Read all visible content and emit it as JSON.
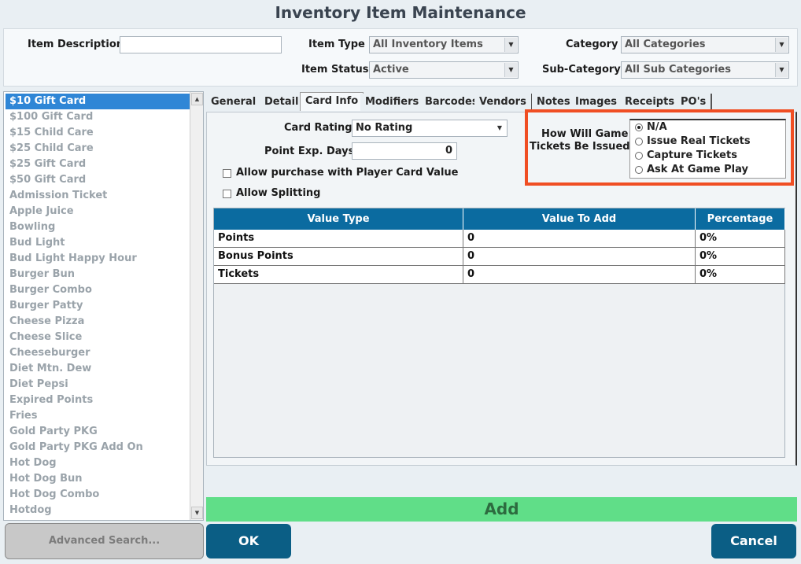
{
  "window": {
    "title": "Inventory Item Maintenance"
  },
  "filters": {
    "item_description_label": "Item Description",
    "item_description_value": "",
    "item_type_label": "Item Type",
    "item_type_value": "All Inventory Items",
    "item_status_label": "Item Status",
    "item_status_value": "Active",
    "category_label": "Category",
    "category_value": "All Categories",
    "subcategory_label": "Sub-Category",
    "subcategory_value": "All Sub Categories"
  },
  "item_list": {
    "items": [
      "$10 Gift Card",
      "$100 Gift Card",
      "$15 Child Care",
      "$25 Child Care",
      "$25 Gift Card",
      "$50 Gift Card",
      "Admission Ticket",
      "Apple Juice",
      "Bowling",
      "Bud Light",
      "Bud Light Happy Hour",
      "Burger Bun",
      "Burger Combo",
      "Burger Patty",
      "Cheese Pizza",
      "Cheese Slice",
      "Cheeseburger",
      "Diet Mtn. Dew",
      "Diet Pepsi",
      "Expired Points",
      "Fries",
      "Gold Party PKG",
      "Gold Party PKG Add On",
      "Hot Dog",
      "Hot Dog Bun",
      "Hot Dog Combo",
      "Hotdog"
    ],
    "selected_index": 0
  },
  "tabs": [
    "General",
    "Detail",
    "Card Info",
    "Modifiers",
    "Barcodes",
    "Vendors",
    "Notes",
    "Images",
    "Receipts",
    "PO's"
  ],
  "active_tab": "Card Info",
  "card_info": {
    "card_rating_label": "Card Rating",
    "card_rating_value": "No Rating",
    "point_exp_days_label": "Point Exp. Days",
    "point_exp_days_value": "0",
    "allow_purchase_label": "Allow purchase with Player Card Value",
    "allow_splitting_label": "Allow Splitting",
    "tickets_label_line1": "How Will Game",
    "tickets_label_line2": "Tickets Be Issued",
    "ticket_options": [
      "N/A",
      "Issue Real Tickets",
      "Capture Tickets",
      "Ask At Game Play"
    ],
    "ticket_selected": "N/A"
  },
  "value_table": {
    "headers": [
      "Value Type",
      "Value To Add",
      "Percentage"
    ],
    "rows": [
      [
        "Points",
        "0",
        "0%"
      ],
      [
        "Bonus Points",
        "0",
        "0%"
      ],
      [
        "Tickets",
        "0",
        "0%"
      ]
    ]
  },
  "buttons": {
    "add": "Add",
    "advanced_search": "Advanced Search...",
    "ok": "OK",
    "cancel": "Cancel"
  },
  "colors": {
    "highlight": "#f04e23",
    "header_blue": "#0b6ba0",
    "add_green": "#60de88",
    "button_blue": "#0b5e85",
    "selected_blue": "#2f86d6"
  }
}
